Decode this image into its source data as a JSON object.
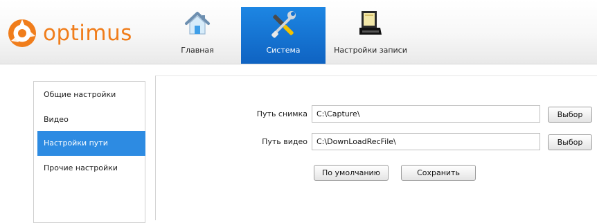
{
  "brand": {
    "name": "optimus",
    "color": "#f07d1b"
  },
  "nav": {
    "tabs": [
      {
        "label": "Главная",
        "icon": "home-icon"
      },
      {
        "label": "Система",
        "icon": "tools-icon",
        "active": true
      },
      {
        "label": "Настройки записи",
        "icon": "recording-drive-icon"
      }
    ]
  },
  "sidebar": {
    "items": [
      {
        "label": "Общие настройки"
      },
      {
        "label": "Видео"
      },
      {
        "label": "Настройки пути",
        "active": true
      },
      {
        "label": "Прочие настройки"
      }
    ]
  },
  "main": {
    "snapshot_path": {
      "label": "Путь снимка",
      "value": "C:\\Capture\\",
      "browse_label": "Выбор"
    },
    "video_path": {
      "label": "Путь видео",
      "value": "C:\\DownLoadRecFile\\",
      "browse_label": "Выбор"
    },
    "default_label": "По умолчанию",
    "save_label": "Сохранить"
  },
  "colors": {
    "accent": "#1d86e3",
    "sidebar_active": "#2d8be2"
  }
}
